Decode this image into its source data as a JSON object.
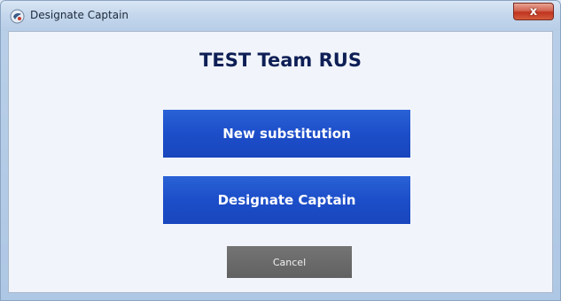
{
  "window": {
    "title": "Designate Captain",
    "app_icon": "app-icon",
    "close_label": "x"
  },
  "dialog": {
    "team_title": "TEST Team RUS",
    "new_substitution_label": "New substitution",
    "designate_captain_label": "Designate Captain",
    "cancel_label": "Cancel"
  },
  "colors": {
    "primary_button": "#1c4ec9",
    "cancel_button": "#666666",
    "title_text": "#0e1f56",
    "close_button": "#c9442d"
  }
}
